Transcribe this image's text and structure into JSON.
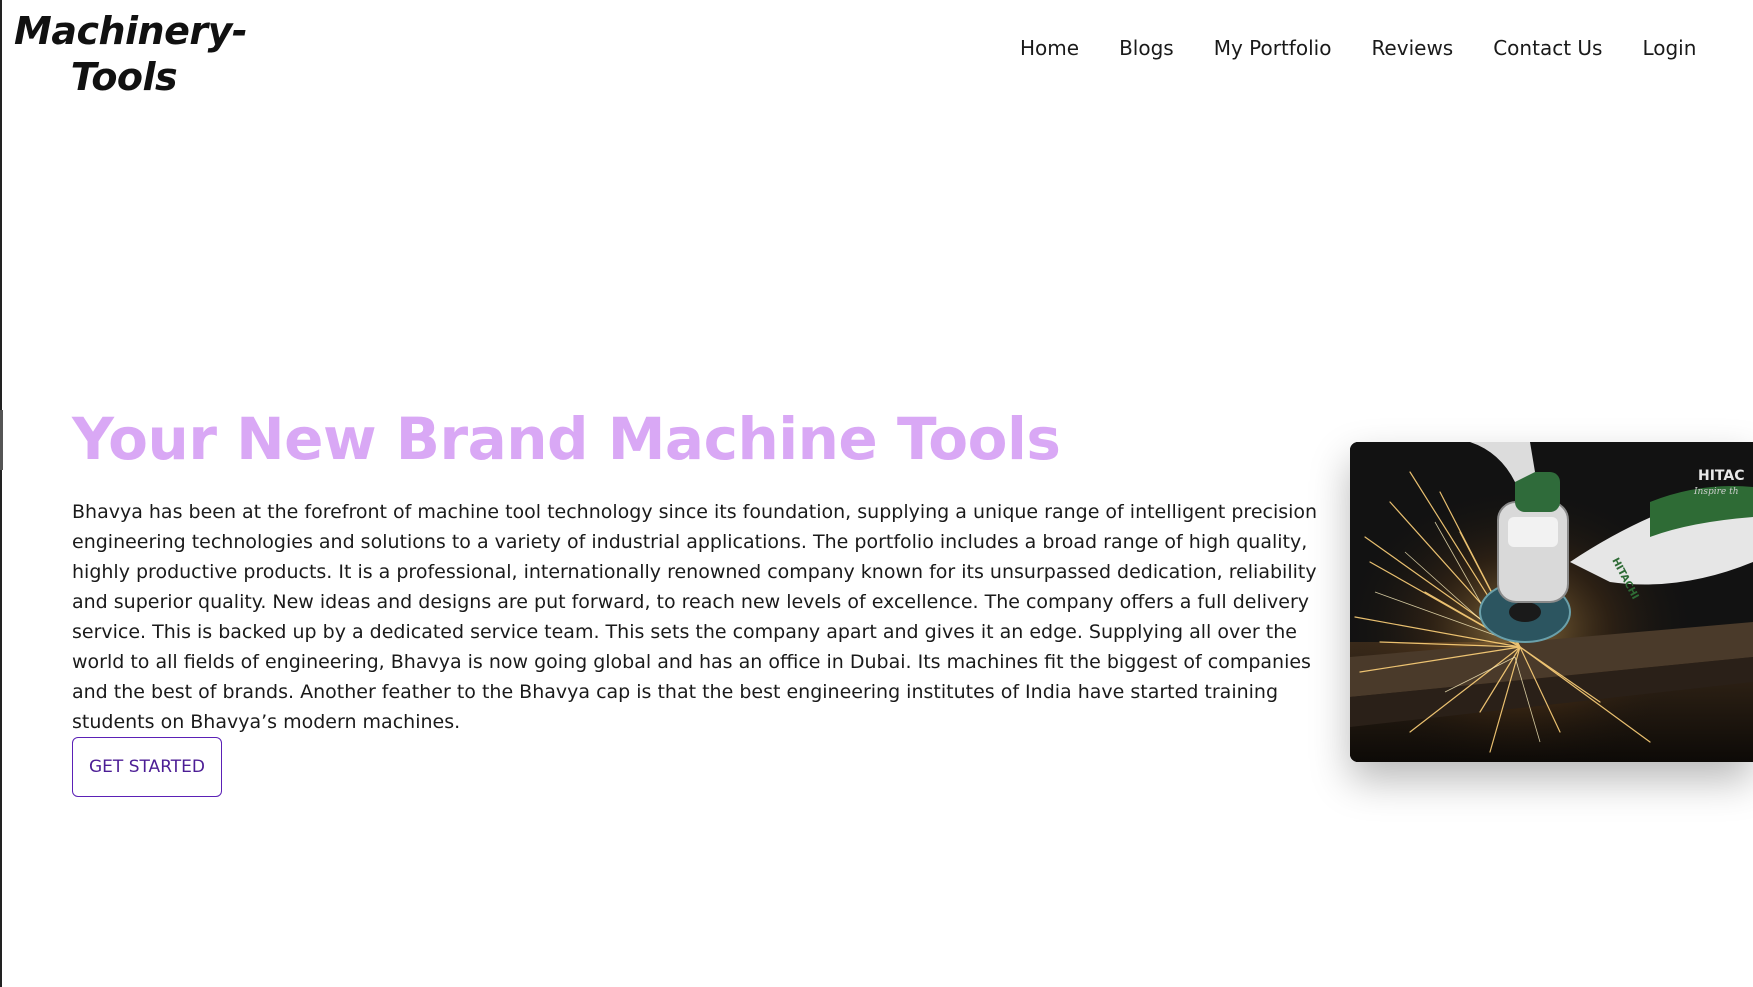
{
  "brand": {
    "logo_line1": "Machinery-",
    "logo_line2": "Tools"
  },
  "nav": {
    "items": [
      {
        "label": "Home"
      },
      {
        "label": "Blogs"
      },
      {
        "label": "My Portfolio"
      },
      {
        "label": "Reviews"
      },
      {
        "label": "Contact Us"
      },
      {
        "label": "Login"
      }
    ]
  },
  "hero": {
    "title": "Your New Brand Machine Tools",
    "body": "Bhavya has been at the forefront of machine tool technology since its foundation, supplying a unique range of intelligent precision engineering technologies and solutions to a variety of industrial applications. The portfolio includes a broad range of high quality, highly productive products. It is a professional, internationally renowned company known for its unsurpassed dedication, reliability and superior quality. New ideas and designs are put forward, to reach new levels of excellence. The company offers a full delivery service. This is backed up by a dedicated service team. This sets the company apart and gives it an edge. Supplying all over the world to all fields of engineering, Bhavya is now going global and has an office in Dubai. Its machines fit the biggest of companies and the best of brands. Another feather to the Bhavya cap is that the best engineering institutes of India have started training students on Bhavya’s modern machines.",
    "cta_label": "GET STARTED",
    "image_brand_text": "HITAC",
    "image_tagline_text": "Inspire th",
    "image_glove_text": "HITACHI"
  },
  "colors": {
    "title": "#d9a8f5",
    "cta_border": "#5b21b6",
    "cta_text": "#4c1d95"
  }
}
